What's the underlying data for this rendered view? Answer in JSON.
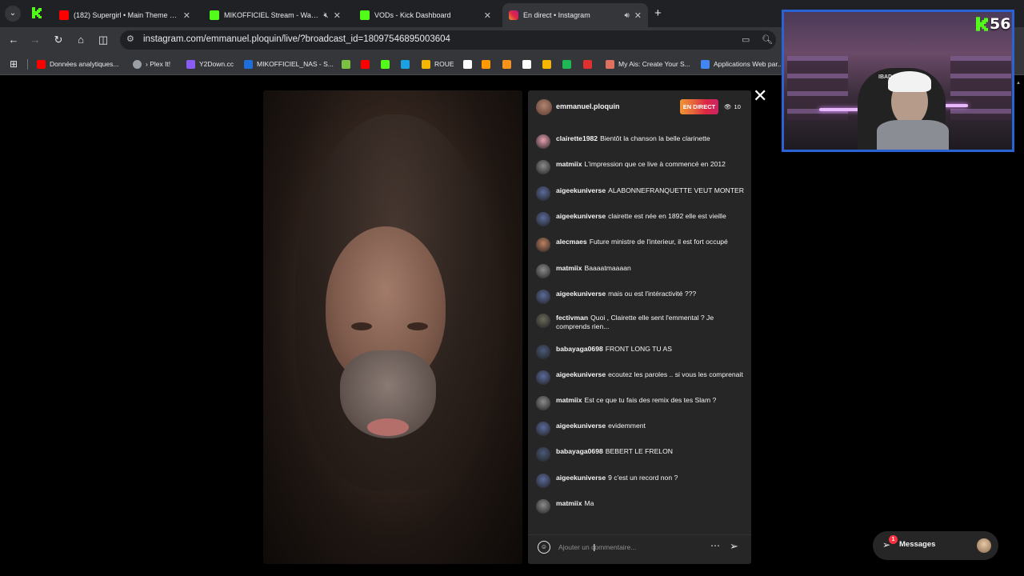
{
  "browser": {
    "tabs": [
      {
        "title": "(182) Supergirl • Main Theme • Je",
        "favicon": "youtube-icon",
        "color": "#ff0000",
        "active": false
      },
      {
        "title": "MIKOFFICIEL Stream - Watch L",
        "favicon": "kick-icon",
        "color": "#53fc18",
        "active": false,
        "muted": true
      },
      {
        "title": "VODs - Kick Dashboard",
        "favicon": "kick-icon",
        "color": "#53fc18",
        "active": false
      },
      {
        "title": "En direct • Instagram",
        "favicon": "instagram-icon",
        "color": "#e1306c",
        "active": true,
        "audio": true
      }
    ],
    "url": "instagram.com/emmanuel.ploquin/live/?broadcast_id=18097546895003604",
    "bookmarks": [
      {
        "label": "Données analytiques...",
        "icon": "youtube-icon",
        "color": "#ff0000"
      },
      {
        "label": "› Plex It!",
        "icon": "globe-icon",
        "color": "#9aa0a6"
      },
      {
        "label": "Y2Down.cc",
        "icon": "y2down-icon",
        "color": "#8a5cf6"
      },
      {
        "label": "MIKOFFICIEL_NAS - S...",
        "icon": "nas-icon",
        "color": "#1e6fd9"
      },
      {
        "label": "",
        "icon": "bookmark-app-icon",
        "color": "#7cc242"
      },
      {
        "label": "",
        "icon": "youtube-icon",
        "color": "#ff0000"
      },
      {
        "label": "",
        "icon": "kick-icon",
        "color": "#53fc18"
      },
      {
        "label": "",
        "icon": "edge-icon",
        "color": "#1ba1e2"
      },
      {
        "label": "ROUE",
        "icon": "wheel-icon",
        "color": "#f4b400"
      },
      {
        "label": "",
        "icon": "diamond-icon",
        "color": "#ffffff"
      },
      {
        "label": "",
        "icon": "bookmark-app-icon",
        "color": "#ff9900"
      },
      {
        "label": "",
        "icon": "bitcoin-icon",
        "color": "#f7931a"
      },
      {
        "label": "",
        "icon": "letter-a-icon",
        "color": "#ffffff"
      },
      {
        "label": "",
        "icon": "arrow-icon",
        "color": "#f4b400"
      },
      {
        "label": "",
        "icon": "spotify-icon",
        "color": "#1db954"
      },
      {
        "label": "",
        "icon": "bookmark-app-icon",
        "color": "#e03030"
      },
      {
        "label": "My Ais: Create Your S...",
        "icon": "ai-icon",
        "color": "#e07060"
      },
      {
        "label": "Applications Web par...",
        "icon": "apps-icon",
        "color": "#4285f4"
      }
    ]
  },
  "live": {
    "host": "emmanuel.ploquin",
    "live_badge": "EN DIRECT",
    "viewer_count": "10",
    "comment_placeholder": "Ajouter un commentaire...",
    "comments": [
      {
        "user": "clairette1982",
        "text": "Bientôt la chanson la belle clarinette",
        "avatar_color": "#e8a0b0"
      },
      {
        "user": "matmiix",
        "text": "L'impression que ce live à commencé en 2012",
        "avatar_color": "#8a8a8a"
      },
      {
        "user": "aigeekuniverse",
        "text": "ALABONNEFRANQUETTE VEUT MONTER",
        "avatar_color": "#5a6a9a"
      },
      {
        "user": "aigeekuniverse",
        "text": "clairette est née en 1892 elle est vieille",
        "avatar_color": "#5a6a9a"
      },
      {
        "user": "alecmaes",
        "text": "Future ministre de l'interieur, il est fort occupé",
        "avatar_color": "#c08060"
      },
      {
        "user": "matmiix",
        "text": "Baaaatmaaaan",
        "avatar_color": "#8a8a8a"
      },
      {
        "user": "aigeekuniverse",
        "text": "mais ou est l'intéractivité ???",
        "avatar_color": "#5a6a9a"
      },
      {
        "user": "fectivman",
        "text": "Quoi , Clairette elle sent l'emmental ? Je comprends rien...",
        "avatar_color": "#6a6a5a"
      },
      {
        "user": "babayaga0698",
        "text": "FRONT LONG TU AS",
        "avatar_color": "#4a5a7a"
      },
      {
        "user": "aigeekuniverse",
        "text": "ecoutez les paroles .. si vous les comprenait",
        "avatar_color": "#5a6a9a"
      },
      {
        "user": "matmiix",
        "text": "Est ce que tu fais des remix des tes Slam ?",
        "avatar_color": "#8a8a8a"
      },
      {
        "user": "aigeekuniverse",
        "text": "evidemment",
        "avatar_color": "#5a6a9a"
      },
      {
        "user": "babayaga0698",
        "text": "BEBERT LE FRELON",
        "avatar_color": "#4a5a7a"
      },
      {
        "user": "aigeekuniverse",
        "text": "9 c'est un record non ?",
        "avatar_color": "#5a6a9a"
      },
      {
        "user": "matmiix",
        "text": "Ma",
        "avatar_color": "#8a8a8a"
      }
    ]
  },
  "messages": {
    "label": "Messages",
    "unread": "1"
  },
  "webcam": {
    "counter": "56",
    "chair_text": "IBAD"
  }
}
